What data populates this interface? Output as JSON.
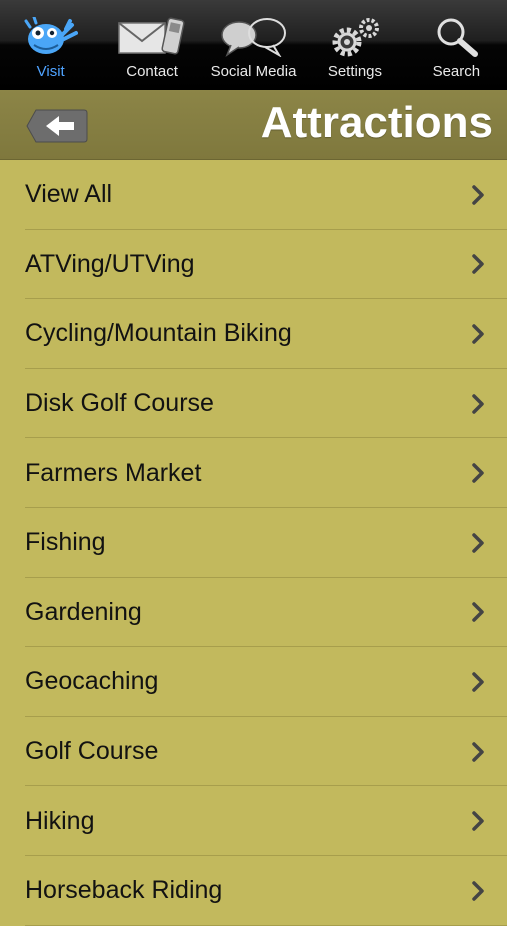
{
  "tabbar": {
    "tabs": [
      {
        "label": "Visit",
        "icon": "mascot-icon",
        "active": true
      },
      {
        "label": "Contact",
        "icon": "envelope-phone-icon",
        "active": false
      },
      {
        "label": "Social Media",
        "icon": "speech-bubbles-icon",
        "active": false
      },
      {
        "label": "Settings",
        "icon": "gears-icon",
        "active": false
      },
      {
        "label": "Search",
        "icon": "magnifier-icon",
        "active": false
      }
    ]
  },
  "header": {
    "title": "Attractions",
    "back_icon": "back-arrow-icon"
  },
  "list": {
    "items": [
      {
        "label": "View All"
      },
      {
        "label": "ATVing/UTVing"
      },
      {
        "label": "Cycling/Mountain Biking"
      },
      {
        "label": "Disk Golf Course"
      },
      {
        "label": "Farmers Market"
      },
      {
        "label": "Fishing"
      },
      {
        "label": "Gardening"
      },
      {
        "label": "Geocaching"
      },
      {
        "label": "Golf Course"
      },
      {
        "label": "Hiking"
      },
      {
        "label": "Horseback Riding"
      }
    ]
  },
  "colors": {
    "list_background": "#c2b95d",
    "header_background": "#857f42",
    "active_tab": "#4fa3ff"
  }
}
